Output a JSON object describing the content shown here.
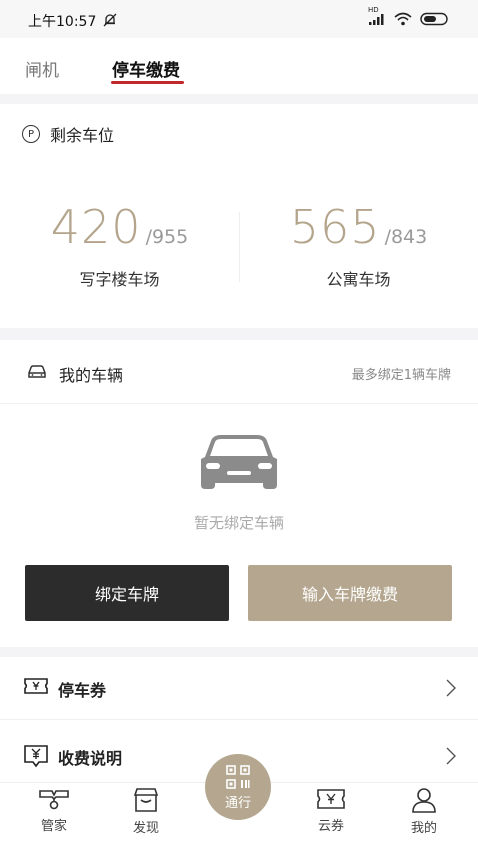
{
  "status_bar": {
    "time": "上午10:57",
    "network": "HD"
  },
  "tabs": [
    {
      "label": "闸机"
    },
    {
      "label": "停车缴费"
    }
  ],
  "remaining_spaces": {
    "title": "剩余车位",
    "lots": [
      {
        "available": "420",
        "total": "/955",
        "name": "写字楼车场"
      },
      {
        "available": "565",
        "total": "/843",
        "name": "公寓车场"
      }
    ]
  },
  "my_vehicles": {
    "title": "我的车辆",
    "hint": "最多绑定1辆车牌",
    "empty_text": "暂无绑定车辆",
    "bind_button": "绑定车牌",
    "pay_button": "输入车牌缴费"
  },
  "list": [
    {
      "label": "停车券"
    },
    {
      "label": "收费说明"
    }
  ],
  "bottom_nav": [
    {
      "label": "管家"
    },
    {
      "label": "发现"
    },
    {
      "label": "通行"
    },
    {
      "label": "云券"
    },
    {
      "label": "我的"
    }
  ],
  "colors": {
    "accent_gold": "#b5a78f",
    "tab_underline": "#c0282c",
    "dark_button": "#2c2c2c"
  }
}
